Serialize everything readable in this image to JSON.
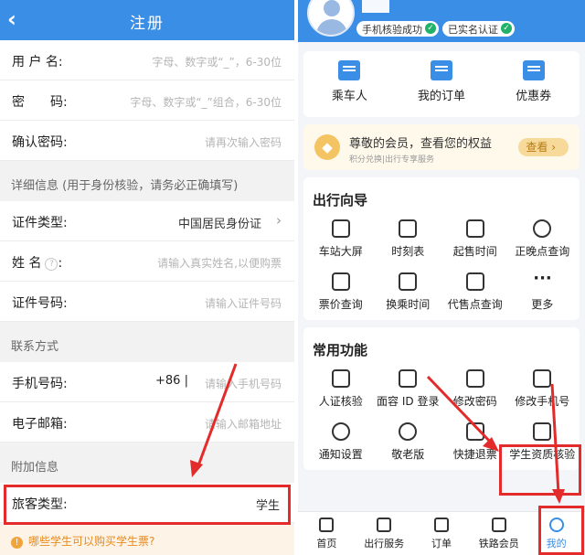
{
  "left": {
    "title": "注册",
    "back_icon": "‹",
    "rows": {
      "username": {
        "label": "用 户 名:",
        "placeholder": "字母、数字或“_”，6-30位"
      },
      "password": {
        "label": "密　　码:",
        "placeholder": "字母、数字或“_”组合，6-30位"
      },
      "confirm": {
        "label": "确认密码:",
        "placeholder": "请再次输入密码"
      },
      "id_type": {
        "label": "证件类型:",
        "value": "中国居民身份证"
      },
      "name": {
        "label": "姓 名",
        "help": "?",
        "placeholder": "请输入真实姓名,以便购票"
      },
      "id_number": {
        "label": "证件号码:",
        "placeholder": "请输入证件号码"
      },
      "phone": {
        "label": "手机号码:",
        "prefix": "+86  |",
        "placeholder": "请输入手机号码"
      },
      "email": {
        "label": "电子邮箱:",
        "placeholder": "请输入邮箱地址"
      },
      "passenger_type": {
        "label": "旅客类型:",
        "value": "学生"
      }
    },
    "sections": {
      "detail": "详细信息 (用于身份核验，请务必正确填写)",
      "contact": "联系方式",
      "extra": "附加信息"
    },
    "tip": "哪些学生可以购买学生票?"
  },
  "right": {
    "badges": [
      "手机核验成功",
      "已实名认证"
    ],
    "quick": [
      "乘车人",
      "我的订单",
      "优惠券"
    ],
    "vip": {
      "title": "尊敬的会员，查看您的权益",
      "subtitle": "积分兑换|出行专享服务",
      "button": "查看 ›"
    },
    "guide": {
      "title": "出行向导",
      "items": [
        "车站大屏",
        "时刻表",
        "起售时间",
        "正晚点查询",
        "票价查询",
        "换乘时间",
        "代售点查询",
        "更多"
      ]
    },
    "functions": {
      "title": "常用功能",
      "items": [
        "人证核验",
        "面容 ID 登录",
        "修改密码",
        "修改手机号",
        "通知设置",
        "敬老版",
        "快捷退票",
        "学生资质核验"
      ]
    },
    "tabs": [
      "首页",
      "出行服务",
      "订单",
      "铁路会员",
      "我的"
    ]
  },
  "colors": {
    "primary": "#3a8ee6",
    "highlight": "#e32b2b",
    "tip": "#e88a1c"
  }
}
